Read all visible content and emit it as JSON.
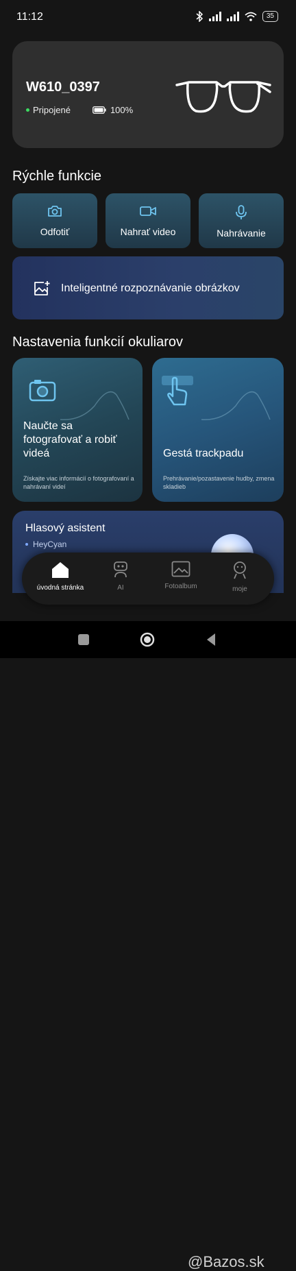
{
  "status_bar": {
    "time": "11:12",
    "battery": "35"
  },
  "device": {
    "name": "W610_0397",
    "status": "Pripojené",
    "battery": "100%"
  },
  "quick_functions": {
    "title": "Rýchle funkcie",
    "photo": "Odfotiť",
    "video": "Nahrať video",
    "audio": "Nahrávanie",
    "ai_recognition": "Inteligentné rozpoznávanie obrázkov"
  },
  "glasses_settings": {
    "title": "Nastavenia funkcií okuliarov",
    "learn_card": {
      "title": "Naučte sa fotografovať a robiť videá",
      "subtitle": "Získajte viac informácií o fotografovaní a nahrávaní videí"
    },
    "trackpad_card": {
      "title": "Gestá trackpadu",
      "subtitle": "Prehrávanie/pozastavenie hudby, zmena skladieb"
    }
  },
  "voice_assistant": {
    "title": "Hlasový asistent",
    "name": "HeyCyan"
  },
  "bottom_nav": {
    "home": "úvodná stránka",
    "ai": "AI",
    "album": "Fotoalbum",
    "me": "moje"
  },
  "watermark": "@Bazos.sk",
  "colors": {
    "connected": "#3ddc62",
    "card_bg": "#2f2f2f",
    "accent_blue": "#2d5367"
  }
}
